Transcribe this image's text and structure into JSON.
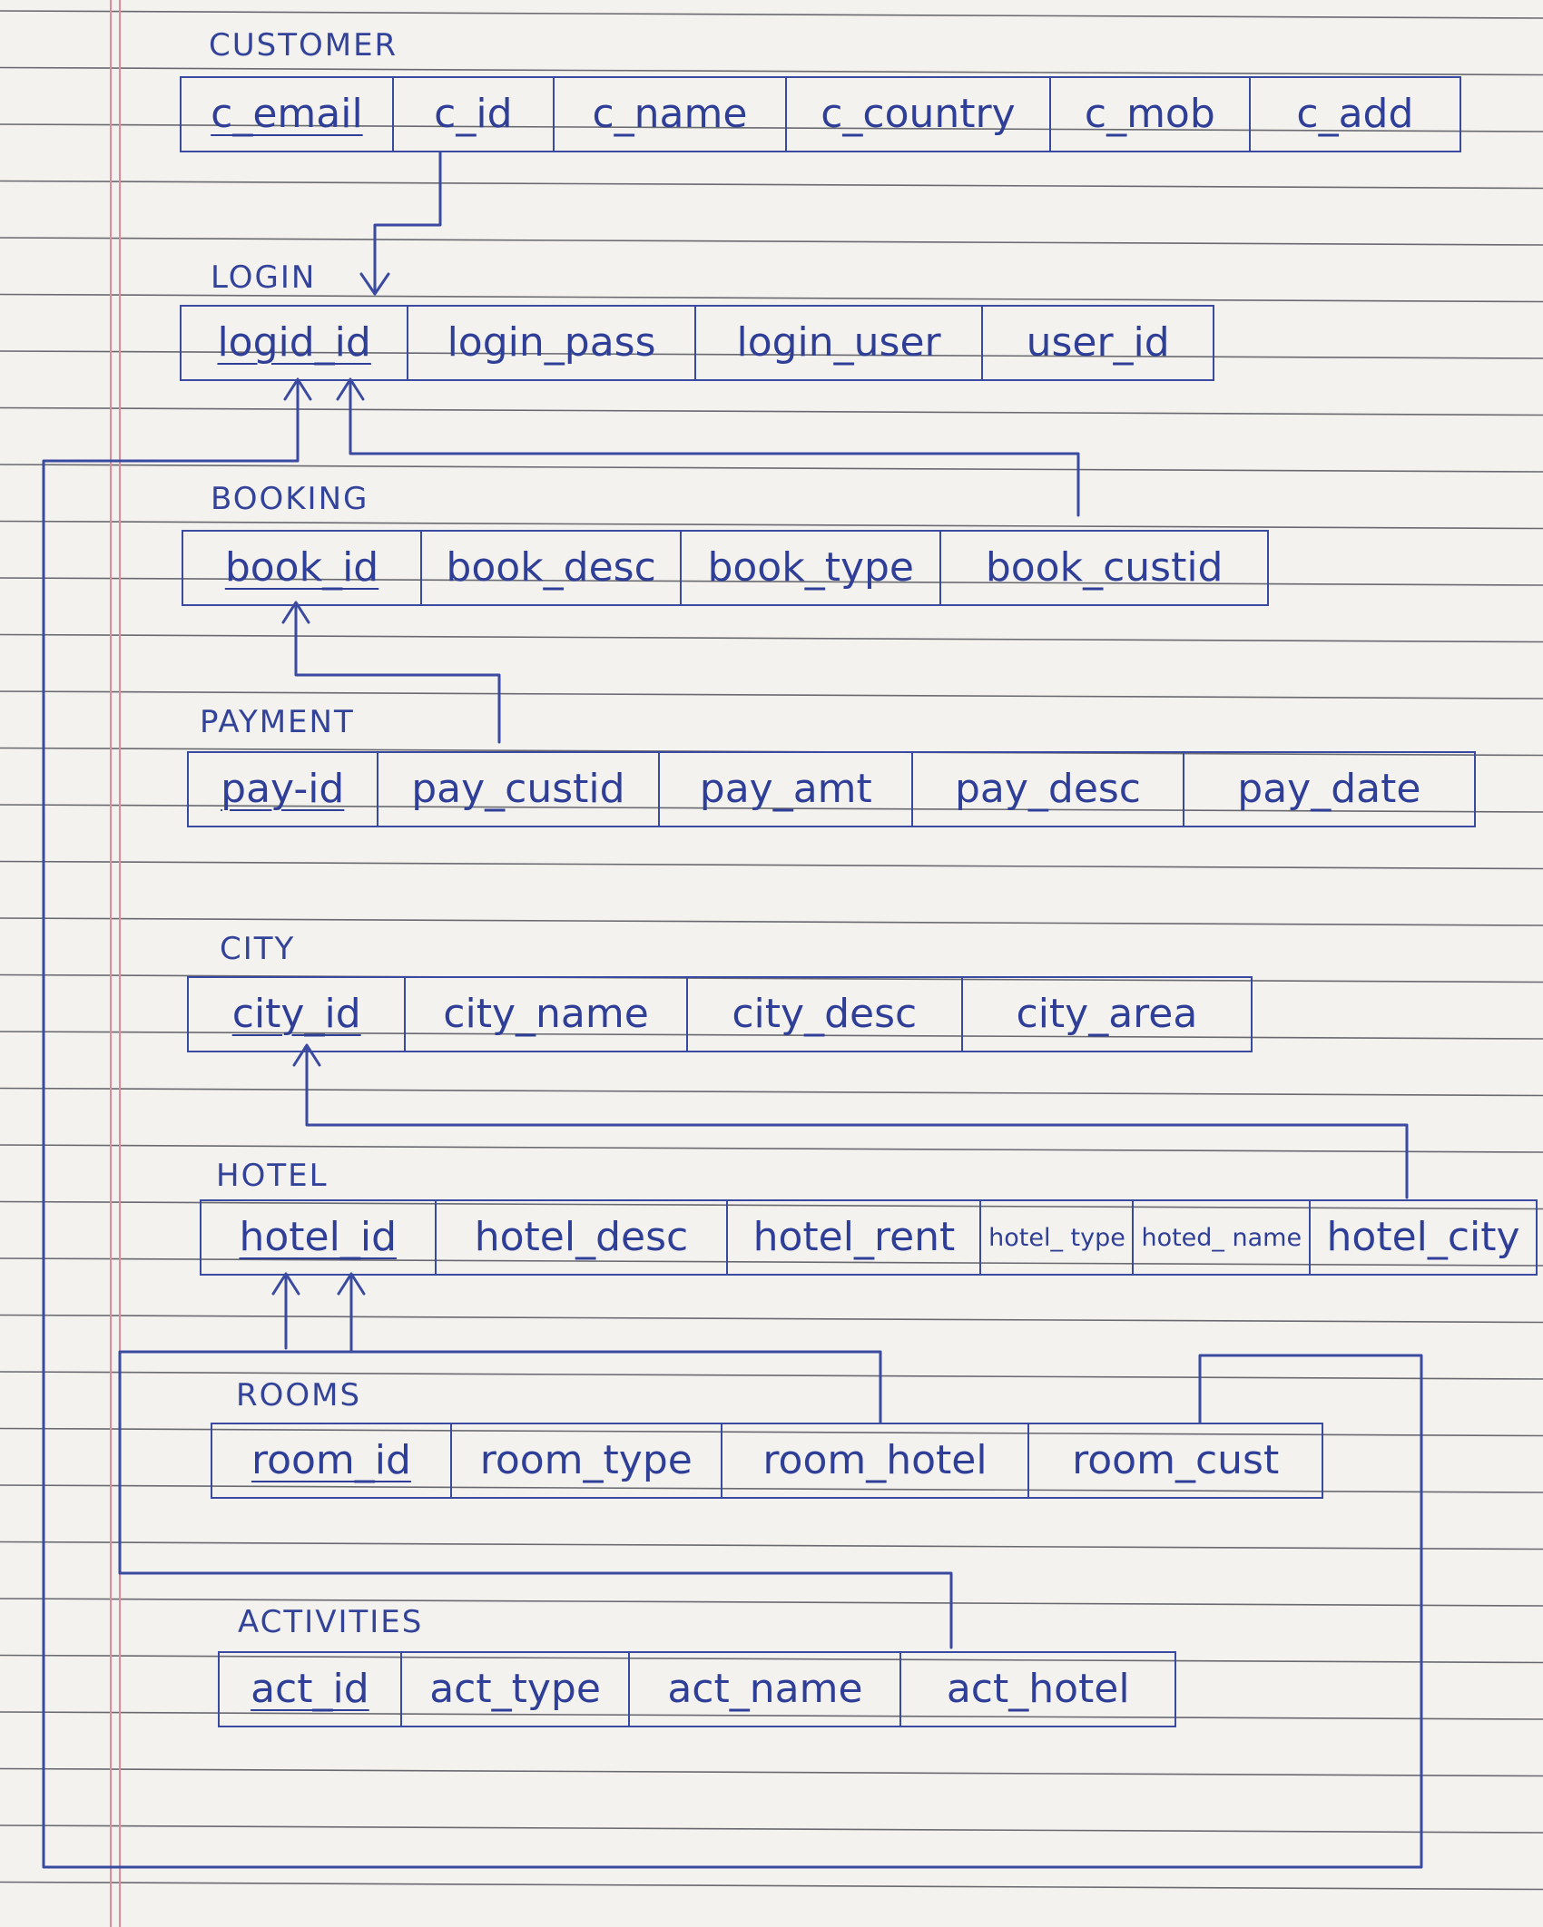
{
  "tables": [
    {
      "id": "customer",
      "title": "CUSTOMER",
      "pk": "c_email",
      "fields": [
        "c_email",
        "c_id",
        "c_name",
        "c_country",
        "c_mob",
        "c_add"
      ]
    },
    {
      "id": "login",
      "title": "LOGIN",
      "pk": "logid_id",
      "fields": [
        "logid_id",
        "login_pass",
        "login_user",
        "user_id"
      ]
    },
    {
      "id": "booking",
      "title": "BOOKING",
      "pk": "book_id",
      "fields": [
        "book_id",
        "book_desc",
        "book_type",
        "book_custid"
      ]
    },
    {
      "id": "payment",
      "title": "PAYMENT",
      "pk": "pay-id",
      "fields": [
        "pay-id",
        "pay_custid",
        "pay_amt",
        "pay_desc",
        "pay_date"
      ]
    },
    {
      "id": "city",
      "title": "CITY",
      "pk": "city_id",
      "fields": [
        "city_id",
        "city_name",
        "city_desc",
        "city_area"
      ]
    },
    {
      "id": "hotel",
      "title": "HOTEL",
      "pk": "hotel_id",
      "fields": [
        "hotel_id",
        "hotel_desc",
        "hotel_rent",
        "hotel_ type",
        "hoted_ name",
        "hotel_city"
      ]
    },
    {
      "id": "rooms",
      "title": "ROOMS",
      "pk": "room_id",
      "fields": [
        "room_id",
        "room_type",
        "room_hotel",
        "room_cust"
      ]
    },
    {
      "id": "activities",
      "title": "ACTIVITIES",
      "pk": "act_id",
      "fields": [
        "act_id",
        "act_type",
        "act_name",
        "act_hotel"
      ]
    }
  ],
  "colors": {
    "ink": "#2f3f98",
    "rule": "#3b3d46",
    "margin": "#e08a9a",
    "paper": "#f3f2ee"
  }
}
